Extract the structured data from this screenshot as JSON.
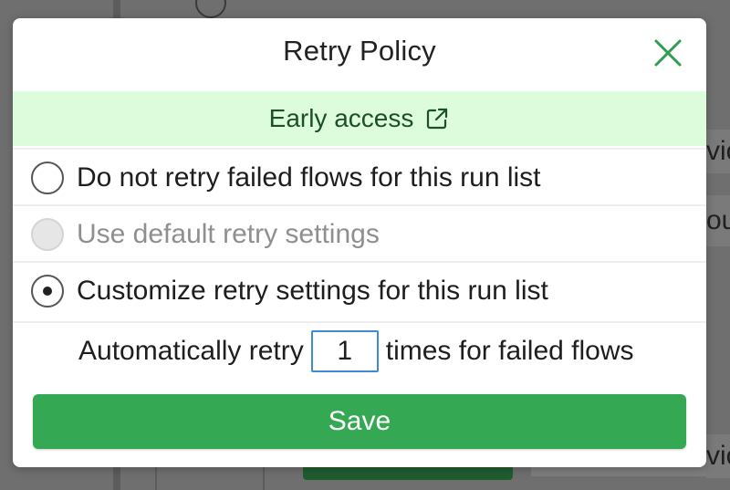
{
  "background": {
    "cells": [
      "vic",
      "ou",
      "vic"
    ]
  },
  "dialog": {
    "title": "Retry Policy",
    "close_icon": "close-icon",
    "banner": {
      "text": "Early access",
      "icon": "external-link-icon"
    },
    "options": [
      {
        "label": "Do not retry failed flows for this run list",
        "selected": false,
        "disabled": false
      },
      {
        "label": "Use default retry settings",
        "selected": false,
        "disabled": true
      },
      {
        "label": "Customize retry settings for this run list",
        "selected": true,
        "disabled": false
      }
    ],
    "retry": {
      "prefix": "Automatically retry",
      "value": "1",
      "suffix": "times for failed flows"
    },
    "save_label": "Save"
  },
  "colors": {
    "accent_green": "#34a853",
    "banner_bg": "#dcfcdc",
    "close_green": "#2e9e4f",
    "input_border": "#3d8bd4"
  }
}
